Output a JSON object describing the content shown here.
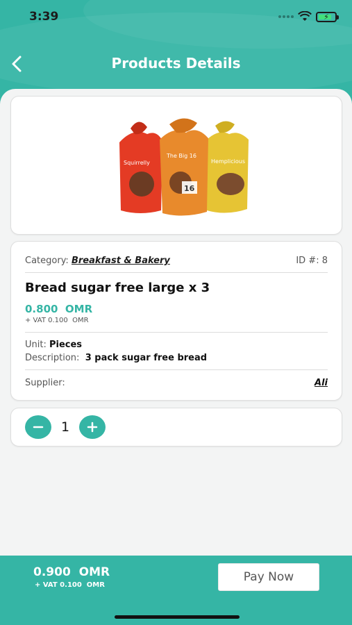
{
  "status_bar": {
    "time": "3:39"
  },
  "header": {
    "title": "Products Details"
  },
  "product": {
    "category_label": "Category:",
    "category": "Breakfast & Bakery",
    "id_label": "ID #:",
    "id": "8",
    "name": "Bread sugar free large x 3",
    "price": "0.800",
    "currency": "OMR",
    "vat_label": "+ VAT 0.100",
    "vat_currency": "OMR",
    "unit_label": "Unit:",
    "unit": "Pieces",
    "description_label": "Description:",
    "description": "3 pack sugar free bread",
    "supplier_label": "Supplier:",
    "supplier": "Ali",
    "image_bags": [
      {
        "brand": "Squirrelly",
        "color": "#e43b24"
      },
      {
        "brand": "The Big 16",
        "color": "#e88a2c"
      },
      {
        "brand": "Hemplicious",
        "color": "#e6c434"
      }
    ]
  },
  "quantity": {
    "value": "1"
  },
  "footer": {
    "total": "0.900",
    "total_currency": "OMR",
    "vat": "+ VAT 0.100",
    "vat_currency": "OMR",
    "pay_label": "Pay Now"
  },
  "colors": {
    "accent": "#35b5a5"
  }
}
